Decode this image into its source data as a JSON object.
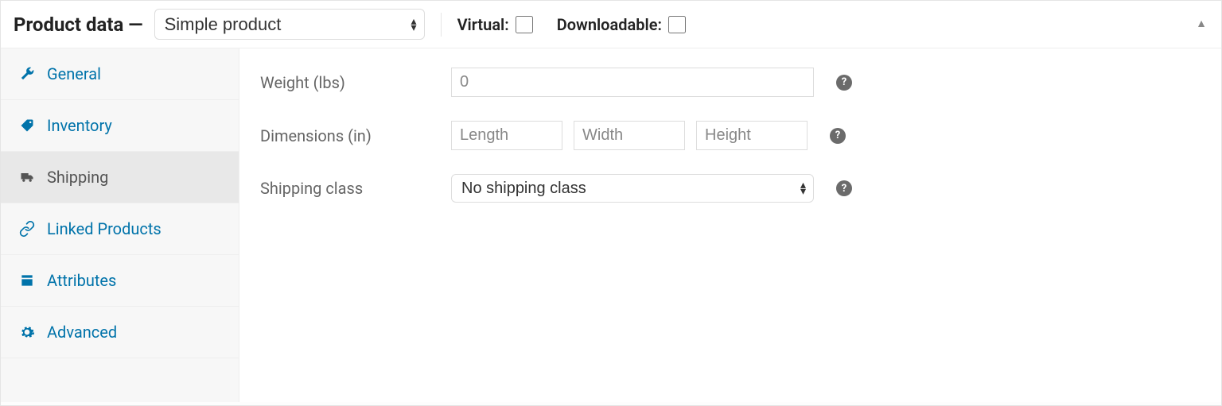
{
  "header": {
    "title": "Product data —",
    "product_type": "Simple product",
    "virtual_label": "Virtual:",
    "virtual_checked": false,
    "downloadable_label": "Downloadable:",
    "downloadable_checked": false
  },
  "tabs": [
    {
      "id": "general",
      "label": "General",
      "icon": "wrench-icon",
      "active": false
    },
    {
      "id": "inventory",
      "label": "Inventory",
      "icon": "tag-icon",
      "active": false
    },
    {
      "id": "shipping",
      "label": "Shipping",
      "icon": "truck-icon",
      "active": true
    },
    {
      "id": "linked",
      "label": "Linked Products",
      "icon": "link-icon",
      "active": false
    },
    {
      "id": "attributes",
      "label": "Attributes",
      "icon": "attributes-icon",
      "active": false
    },
    {
      "id": "advanced",
      "label": "Advanced",
      "icon": "gear-icon",
      "active": false
    }
  ],
  "shipping": {
    "weight_label": "Weight (lbs)",
    "weight_placeholder": "0",
    "dimensions_label": "Dimensions (in)",
    "length_placeholder": "Length",
    "width_placeholder": "Width",
    "height_placeholder": "Height",
    "shipping_class_label": "Shipping class",
    "shipping_class_value": "No shipping class",
    "help": "?"
  }
}
